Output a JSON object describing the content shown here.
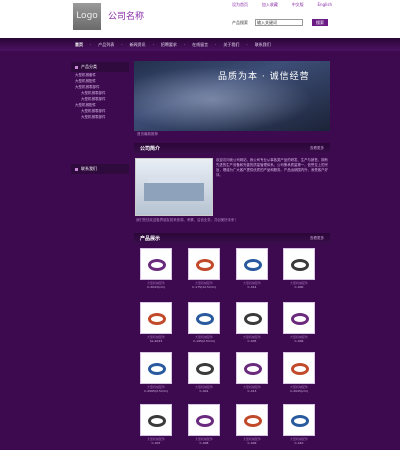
{
  "header": {
    "logo": "Logo",
    "company": "公司名称",
    "toplinks": [
      "设为首页",
      "加入收藏",
      "中文版",
      "English"
    ],
    "search_label": "产品搜索",
    "search_value": "输入关键词",
    "search_button": "搜索"
  },
  "nav": {
    "items": [
      "首页",
      "产品列表",
      "新闻资讯",
      "招聘要求",
      "在线留言",
      "关于我们",
      "联系我们"
    ]
  },
  "sidebar": {
    "title": "产品分类",
    "categories": [
      "大型机械套件",
      "大型机械配件",
      "大型机械零部件",
      "大型机械零部件",
      "大型机械零部件",
      "大型机械配件",
      "大型机械零部件",
      "大型机械零部件"
    ],
    "contact_title": "联系我们"
  },
  "banner": {
    "text": "品质为本 · 诚信经营",
    "caption": "首页最新推荐"
  },
  "intro": {
    "title": "公司简介",
    "more": "查看更多",
    "text": "欢迎访问我公司网站，我公司专业从事各类产品的研发、生产与销售，拥有先进的生产设备和完善的质量管理体系。公司秉承质量第一、信誉至上的宗旨，竭诚为广大客户提供优质的产品和服务。产品远销国内外，深受客户好评。",
    "foot": "我们热忱欢迎各界朋友前来参观、考察、洽谈业务，共创美好未来！"
  },
  "products": {
    "title": "产品展示",
    "more": "查看更多",
    "items": [
      {
        "name": "大型机械配件",
        "code": "C-2043(xm)"
      },
      {
        "name": "大型机械配件",
        "code": "C-175(12.5mm)"
      },
      {
        "name": "大型机械配件",
        "code": "C-414"
      },
      {
        "name": "大型机械配件",
        "code": "C-400"
      },
      {
        "name": "大型机械配件",
        "code": "SL-2043"
      },
      {
        "name": "大型机械配件",
        "code": "C-195(2.5mm)"
      },
      {
        "name": "大型机械配件",
        "code": "C-405"
      },
      {
        "name": "大型机械配件",
        "code": "C-406"
      },
      {
        "name": "大型机械配件",
        "code": "C-2065(2.5mm)"
      },
      {
        "name": "大型机械配件",
        "code": "C-401"
      },
      {
        "name": "大型机械配件",
        "code": "C-413"
      },
      {
        "name": "大型机械配件",
        "code": "C-2045(xm)"
      },
      {
        "name": "大型机械配件",
        "code": "C-407"
      },
      {
        "name": "大型机械配件",
        "code": "C-408"
      },
      {
        "name": "大型机械配件",
        "code": "C-409"
      },
      {
        "name": "大型机械配件",
        "code": "C-410"
      }
    ]
  },
  "colors": {
    "page_bg": "#3d0a4f",
    "accent": "#8a2aa8"
  }
}
